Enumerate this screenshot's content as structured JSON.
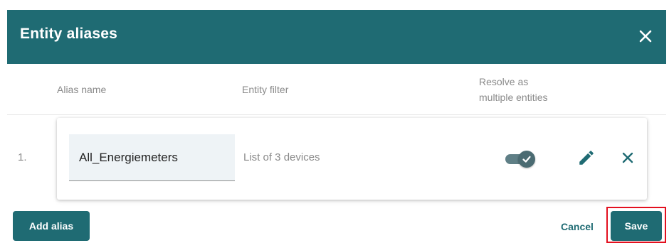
{
  "dialog": {
    "title": "Entity aliases",
    "close_icon": "close-icon"
  },
  "columns": {
    "alias_name": "Alias name",
    "entity_filter": "Entity filter",
    "resolve_line1": "Resolve as",
    "resolve_line2": "multiple entities"
  },
  "aliases": [
    {
      "index": "1.",
      "name": "All_Energiemeters",
      "filter": "List of 3 devices",
      "resolve_multiple": true
    }
  ],
  "actions": {
    "add_alias": "Add alias",
    "cancel": "Cancel",
    "save": "Save"
  },
  "colors": {
    "primary": "#1f6b73",
    "highlight": "#e3101f",
    "field_bg": "#eef3f6"
  }
}
